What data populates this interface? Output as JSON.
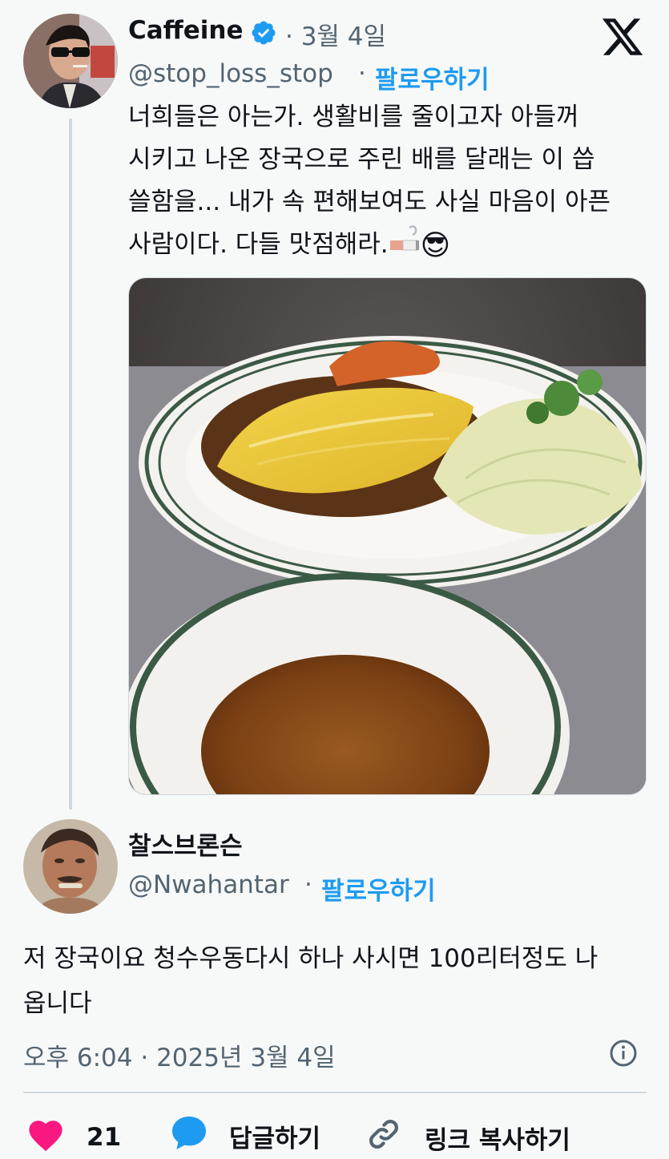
{
  "tweet": {
    "author_name": "Caffeine",
    "date": "· 3월 4일",
    "handle": "@stop_loss_stop",
    "dot": "·",
    "follow_label": "팔로우하기",
    "text_lines": [
      "너희들은 아는가. 생활비를 줄이고자 아들꺼",
      "시키고 나온 장국으로 주린 배를 달래는 이 씁",
      "쓸함을... 내가 속 편해보여도 사실 마음이 아픈",
      "사람이다. 다들 맛점해라."
    ],
    "emoji": "😎"
  },
  "reply": {
    "author_name": "찰스브론슨",
    "handle": "@Nwahantar",
    "dot": "·",
    "follow_label": "팔로우하기",
    "text_lines": [
      "저 장국이요 청수우동다시 하나 사시면 100리터정도 나",
      "옵니다"
    ],
    "timestamp": "오후 6:04 · 2025년 3월 4일"
  },
  "actions": {
    "like_count": "21",
    "reply_label": "답글하기",
    "copy_link_label": "링크 복사하기"
  },
  "colors": {
    "background": "#f7f9f9",
    "accent": "#1d9bf0",
    "verified": "#1d9bf0",
    "like": "#f91880",
    "muted": "#536471"
  },
  "icons": [
    "verified-badge-icon",
    "x-logo-icon",
    "info-icon",
    "heart-icon",
    "reply-bubble-icon",
    "link-icon",
    "cigarette-icon"
  ]
}
